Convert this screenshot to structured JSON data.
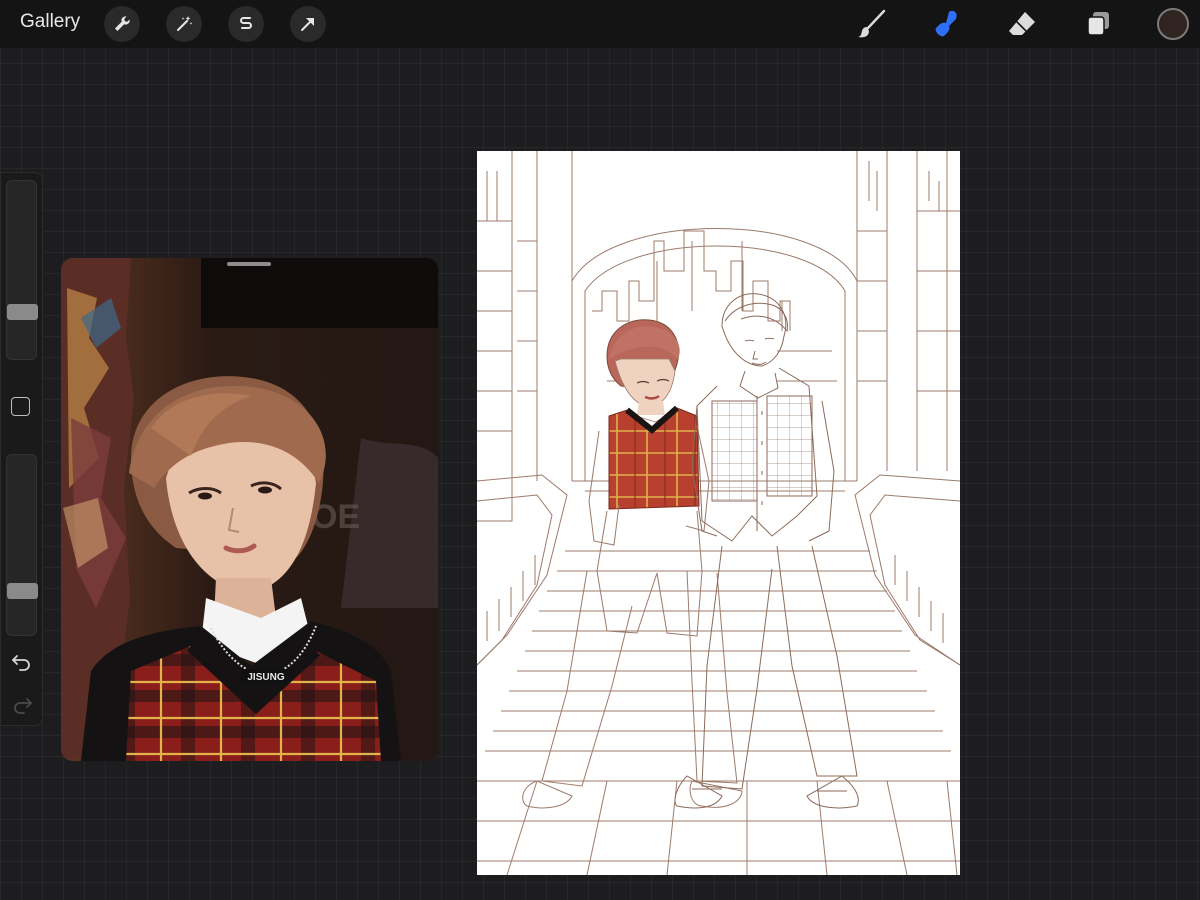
{
  "topbar": {
    "gallery_label": "Gallery",
    "left_tools": [
      "wrench-icon",
      "magic-wand-icon",
      "selection-icon",
      "transform-arrow-icon"
    ],
    "right_tools": [
      "brush-icon",
      "smudge-icon",
      "eraser-icon",
      "layers-icon"
    ],
    "active_tool": "smudge-icon",
    "active_color": "#2f6ff5",
    "current_color": "#2f2420"
  },
  "sidebar": {
    "brush_size_level": 0.24,
    "opacity_level": 0.22,
    "icons": [
      "modifier-square-icon",
      "undo-icon",
      "redo-icon"
    ]
  },
  "reference": {
    "caption_necklace": "JISUNG"
  },
  "colors": {
    "background": "#1d1d1f",
    "toolbar": "#141414",
    "line_art": "#9c7b6b",
    "plaid_red": "#b8402e",
    "plaid_yellow": "#e1b34a"
  }
}
